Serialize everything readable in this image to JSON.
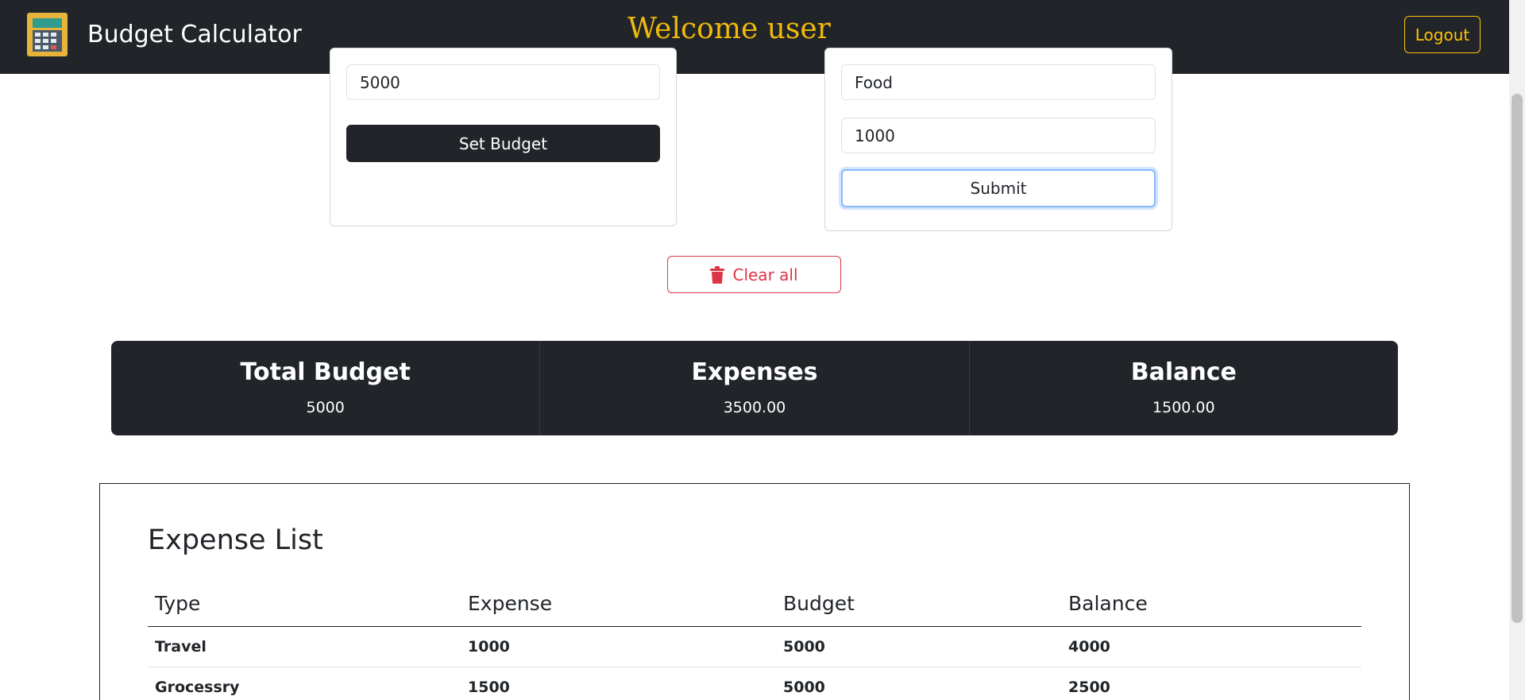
{
  "navbar": {
    "brand": "Budget Calculator",
    "welcome": "Welcome user",
    "logout_label": "Logout",
    "logo_icon": "calculator-icon",
    "accent_color": "#ffc107"
  },
  "budget_form": {
    "budget_value": "5000",
    "set_budget_label": "Set Budget"
  },
  "expense_form": {
    "type_value": "Food",
    "amount_value": "1000",
    "submit_label": "Submit"
  },
  "clear_all": {
    "label": "Clear all",
    "icon": "trash-icon",
    "color": "#dc3545"
  },
  "summary": {
    "total_budget_label": "Total Budget",
    "total_budget_value": "5000",
    "expenses_label": "Expenses",
    "expenses_value": "3500.00",
    "balance_label": "Balance",
    "balance_value": "1500.00"
  },
  "expense_list": {
    "title": "Expense List",
    "columns": [
      "Type",
      "Expense",
      "Budget",
      "Balance"
    ],
    "rows": [
      [
        "Travel",
        "1000",
        "5000",
        "4000"
      ],
      [
        "Grocessry",
        "1500",
        "5000",
        "2500"
      ]
    ]
  }
}
